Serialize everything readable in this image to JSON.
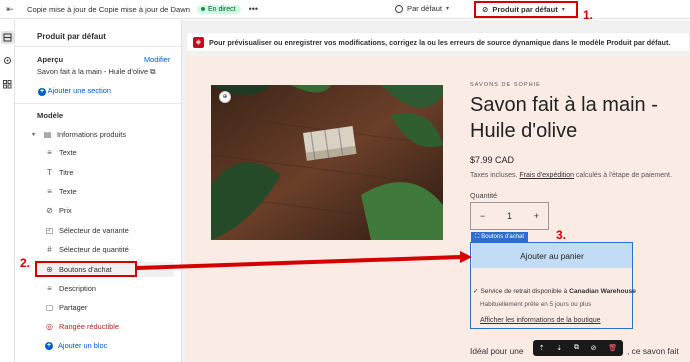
{
  "topbar": {
    "theme_name": "Copie mise à jour de Copie mise à jour de Dawn",
    "live_badge": "En direct",
    "more": "•••",
    "context": "Par défaut",
    "template": "Produit par défaut"
  },
  "annotations": [
    "1.",
    "2.",
    "3."
  ],
  "panel": {
    "title": "Produit par défaut",
    "apercu": "Aperçu",
    "modifier": "Modifier",
    "product": "Savon fait à la main - Huile d'olive",
    "add_section": "Ajouter une section",
    "modele": "Modèle",
    "section": "Informations produits",
    "blocks": [
      {
        "label": "Texte",
        "icon": "text-icon"
      },
      {
        "label": "Titre",
        "icon": "title-icon"
      },
      {
        "label": "Texte",
        "icon": "text-icon"
      },
      {
        "label": "Prix",
        "icon": "price-icon"
      },
      {
        "label": "Sélecteur de variante",
        "icon": "variant-icon"
      },
      {
        "label": "Sélecteur de quantité",
        "icon": "quantity-icon"
      },
      {
        "label": "Boutons d'achat",
        "icon": "buy-buttons-icon"
      },
      {
        "label": "Description",
        "icon": "description-icon"
      },
      {
        "label": "Partager",
        "icon": "share-icon"
      },
      {
        "label": "Rangée réductible",
        "icon": "collapsible-icon"
      }
    ],
    "add_block": "Ajouter un bloc"
  },
  "banner": {
    "message": "Pour prévisualiser ou enregistrer vos modifications, corrigez la ou les erreurs de source dynamique dans le modèle Produit par défaut."
  },
  "product": {
    "brand": "SAVONS DE SOPHIE",
    "title_line1": "Savon fait à la main -",
    "title_line2": "Huile d'olive",
    "price": "$7.99 CAD",
    "tax_before": "Taxes incluses. ",
    "tax_link": "Frais d'expédition",
    "tax_after": " calculés à l'étape de paiement.",
    "quantity_label": "Quantité",
    "quantity_minus": "−",
    "quantity_value": "1",
    "quantity_plus": "+",
    "block_tag": "Boutons d'achat",
    "add_to_cart": "Ajouter au panier",
    "pickup_text": "Service de retrait disponible à ",
    "pickup_store": "Canadian Warehouse",
    "pickup_ready": "Habituellement prête en 5 jours ou plus",
    "store_link": "Afficher les informations de la boutique",
    "description_start": "Idéal pour une",
    "description_end": ", ce savon fait"
  },
  "colors": {
    "accent": "#005bd3",
    "annotation": "#d40000",
    "selection": "#2c6ecb",
    "error": "#c70a24",
    "shop_bg": "#fbebe5"
  }
}
